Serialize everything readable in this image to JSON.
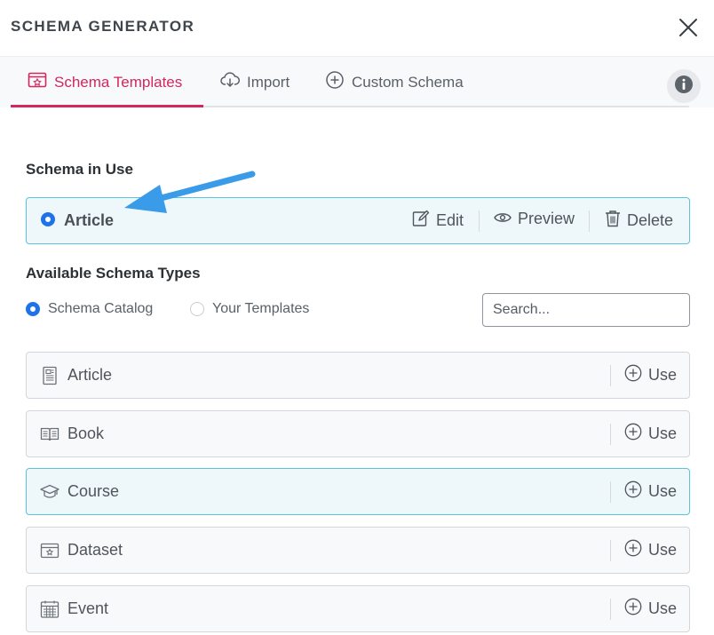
{
  "header": {
    "title": "SCHEMA GENERATOR"
  },
  "tabs": [
    {
      "label": "Schema Templates",
      "active": true,
      "icon": "template-icon"
    },
    {
      "label": "Import",
      "active": false,
      "icon": "cloud-download-icon"
    },
    {
      "label": "Custom Schema",
      "active": false,
      "icon": "plus-circle-icon"
    }
  ],
  "colors": {
    "accent": "#d1285d",
    "radio": "#1e73e8",
    "highlight_border": "#5cc3dc",
    "arrow": "#3a9be8"
  },
  "schema_in_use": {
    "heading": "Schema in Use",
    "name": "Article",
    "actions": {
      "edit": "Edit",
      "preview": "Preview",
      "delete": "Delete"
    }
  },
  "available": {
    "heading": "Available Schema Types",
    "options": [
      {
        "label": "Schema Catalog",
        "selected": true
      },
      {
        "label": "Your Templates",
        "selected": false
      }
    ],
    "search_placeholder": "Search...",
    "use_label": "Use",
    "items": [
      {
        "label": "Article",
        "icon": "article-icon"
      },
      {
        "label": "Book",
        "icon": "book-icon"
      },
      {
        "label": "Course",
        "icon": "graduation-cap-icon",
        "highlighted": true
      },
      {
        "label": "Dataset",
        "icon": "dataset-icon"
      },
      {
        "label": "Event",
        "icon": "calendar-icon"
      }
    ]
  }
}
